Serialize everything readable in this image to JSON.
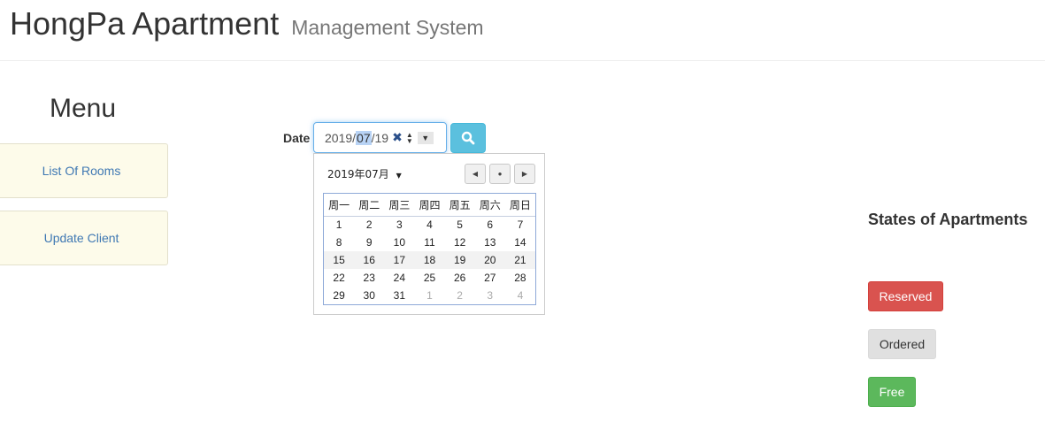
{
  "header": {
    "brand": "HongPa Apartment",
    "subtitle": "Management System"
  },
  "menu": {
    "title": "Menu",
    "items": [
      {
        "label": "List Of Rooms"
      },
      {
        "label": "Update Client"
      }
    ]
  },
  "date_filter": {
    "label": "Date",
    "value": {
      "year": "2019",
      "sep": "/",
      "month": "07",
      "day": "19"
    },
    "clear_glyph": "✖",
    "spin_up": "▲",
    "spin_down": "▼",
    "dropdown_glyph": "▼",
    "search_icon": "search-icon"
  },
  "calendar": {
    "month_label": "2019年07月",
    "caret": "▼",
    "nav": {
      "prev": "◀",
      "today": "●",
      "next": "▶"
    },
    "weekdays": [
      "周一",
      "周二",
      "周三",
      "周四",
      "周五",
      "周六",
      "周日"
    ],
    "weeks": [
      [
        "1",
        "2",
        "3",
        "4",
        "5",
        "6",
        "7"
      ],
      [
        "8",
        "9",
        "10",
        "11",
        "12",
        "13",
        "14"
      ],
      [
        "15",
        "16",
        "17",
        "18",
        "19",
        "20",
        "21"
      ],
      [
        "22",
        "23",
        "24",
        "25",
        "26",
        "27",
        "28"
      ],
      [
        "29",
        "30",
        "31",
        "1",
        "2",
        "3",
        "4"
      ]
    ],
    "selected_day": "19"
  },
  "states": {
    "title": "States of Apartments",
    "reserved": "Reserved",
    "ordered": "Ordered",
    "free": "Free"
  },
  "colors": {
    "accent_info": "#5bc0de",
    "reserved": "#d9534f",
    "ordered": "#e0e0e0",
    "free": "#5cb85c",
    "menu_bg": "#fdfbea",
    "link": "#3f78b3"
  }
}
